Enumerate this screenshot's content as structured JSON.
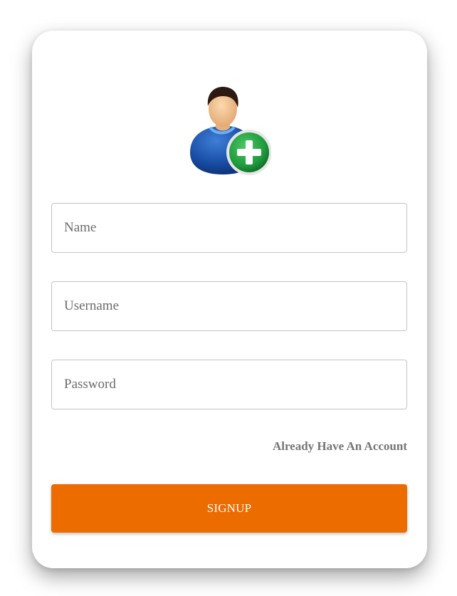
{
  "form": {
    "name_placeholder": "Name",
    "username_placeholder": "Username",
    "password_placeholder": "Password",
    "login_link_label": "Already Have An Account",
    "signup_label": "SIGNUP"
  },
  "icons": {
    "avatar": "add-user-icon"
  },
  "colors": {
    "accent": "#ec6c00",
    "card_background": "#ffffff",
    "link_text": "#757575",
    "plus_badge": "#1e9a3c"
  }
}
